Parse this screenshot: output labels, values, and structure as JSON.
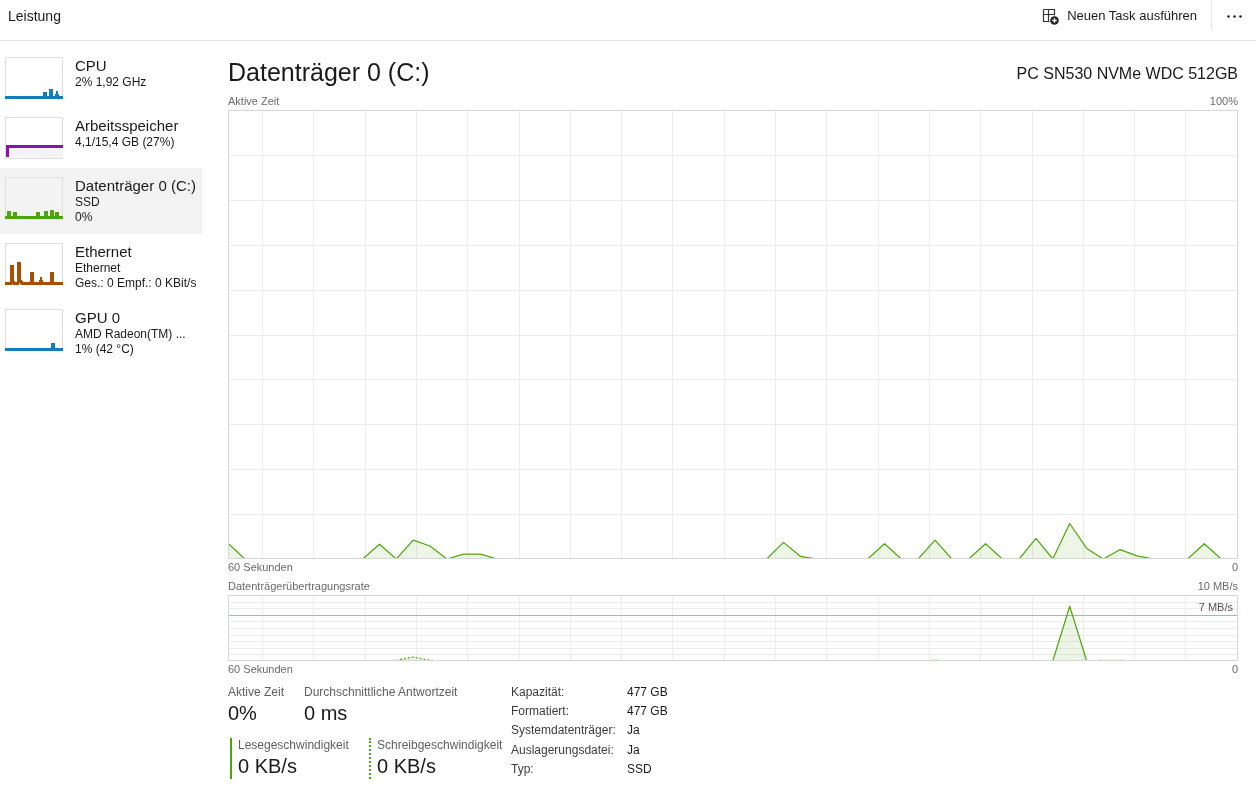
{
  "header": {
    "title": "Leistung",
    "actions": [
      {
        "label": "Neuen Task ausführen"
      }
    ]
  },
  "sidebar": {
    "items": [
      {
        "title": "CPU",
        "lines": [
          "2% 1,92 GHz"
        ],
        "color": "#117dbb",
        "selected": false
      },
      {
        "title": "Arbeitsspeicher",
        "lines": [
          "4,1/15,4 GB (27%)"
        ],
        "color": "#8b12ae",
        "selected": false
      },
      {
        "title": "Datenträger 0 (C:)",
        "lines": [
          "SSD",
          "0%"
        ],
        "color": "#4da60c",
        "selected": true
      },
      {
        "title": "Ethernet",
        "lines": [
          "Ethernet",
          "Ges.: 0 Empf.: 0 KBit/s"
        ],
        "color": "#a74f01",
        "selected": false
      },
      {
        "title": "GPU 0",
        "lines": [
          "AMD Radeon(TM) ...",
          "1% (42 °C)"
        ],
        "color": "#117dbb",
        "selected": false
      }
    ]
  },
  "detail": {
    "title": "Datenträger 0 (C:)",
    "model": "PC SN530 NVMe WDC 512GB",
    "graphs": [
      {
        "title": "Aktive Zeit",
        "scale_label": "100%",
        "start_label": "60 Sekunden",
        "end_label": "0"
      },
      {
        "title": "Datenträgerübertragungsrate",
        "scale_label": "10 MB/s",
        "marker_label": "7 MB/s",
        "start_label": "60 Sekunden",
        "end_label": "0"
      }
    ],
    "stats": [
      {
        "label": "Aktive Zeit",
        "value": "0%"
      },
      {
        "label": "Durchschnittliche Antwortzeit",
        "value": "0 ms"
      }
    ],
    "rates": [
      {
        "kind": "solid",
        "label": "Lesegeschwindigkeit",
        "value": "0 KB/s"
      },
      {
        "kind": "dotted",
        "label": "Schreibgeschwindigkeit",
        "value": "0 KB/s"
      }
    ],
    "properties": [
      {
        "label": "Kapazität:",
        "value": "477 GB"
      },
      {
        "label": "Formatiert:",
        "value": "477 GB"
      },
      {
        "label": "Systemdatenträger:",
        "value": "Ja"
      },
      {
        "label": "Auslagerungsdatei:",
        "value": "Ja"
      },
      {
        "label": "Typ:",
        "value": "SSD"
      }
    ]
  }
}
